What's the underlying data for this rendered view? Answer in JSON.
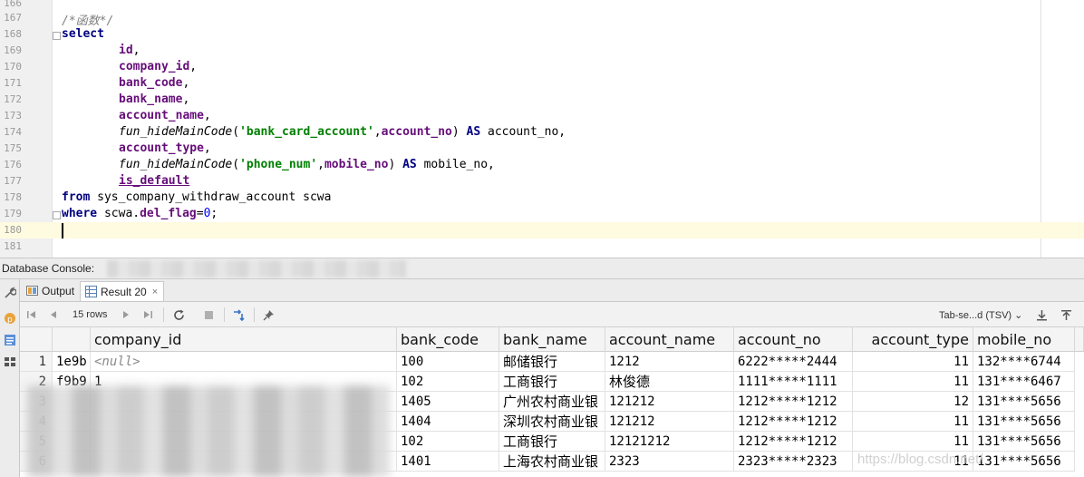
{
  "editor": {
    "lines": [
      {
        "n": "166",
        "code": ""
      },
      {
        "n": "167",
        "code": "/*函数*/"
      },
      {
        "n": "168",
        "code": "select"
      },
      {
        "n": "169",
        "code": "id,"
      },
      {
        "n": "170",
        "code": "company_id,"
      },
      {
        "n": "171",
        "code": "bank_code,"
      },
      {
        "n": "172",
        "code": "bank_name,"
      },
      {
        "n": "173",
        "code": "account_name,"
      },
      {
        "n": "174",
        "code": "fun_hideMainCode('bank_card_account',account_no) AS account_no,"
      },
      {
        "n": "175",
        "code": "account_type,"
      },
      {
        "n": "176",
        "code": "fun_hideMainCode('phone_num',mobile_no) AS mobile_no,"
      },
      {
        "n": "177",
        "code": "is_default"
      },
      {
        "n": "178",
        "code": "from sys_company_withdraw_account scwa"
      },
      {
        "n": "179",
        "code": "where scwa.del_flag=0;"
      },
      {
        "n": "180",
        "code": ""
      },
      {
        "n": "181",
        "code": ""
      }
    ],
    "tokens": {
      "comment": "/*函数*/",
      "select": "select",
      "id": "id",
      "company_id": "company_id",
      "bank_code": "bank_code",
      "bank_name": "bank_name",
      "account_name": "account_name",
      "fn1": "fun_hideMainCode",
      "str1": "'bank_card_account'",
      "account_no": "account_no",
      "as": "AS",
      "alias1": " account_no,",
      "account_type": "account_type",
      "fn2": "fun_hideMainCode",
      "str2": "'phone_num'",
      "mobile_no": "mobile_no",
      "alias2": " mobile_no,",
      "is_default": "is_default",
      "from": "from",
      "table": " sys_company_withdraw_account scwa",
      "where": "where",
      "where_rest": " scwa.",
      "del_flag": "del_flag",
      "eq": "=",
      "zero": "0",
      "semicolon": ";"
    }
  },
  "console": {
    "title": "Database Console:"
  },
  "tabs": [
    {
      "label": "Output",
      "icon": "output-icon"
    },
    {
      "label": "Result 20",
      "icon": "table-icon",
      "close": "×"
    }
  ],
  "toolbar": {
    "rows": "15 rows",
    "format": "Tab-se...d (TSV)",
    "format_arrow": "⌄"
  },
  "grid": {
    "columns": [
      "company_id",
      "bank_code",
      "bank_name",
      "account_name",
      "account_no",
      "account_type",
      "mobile_no"
    ],
    "rows": [
      {
        "num": "1",
        "id": "1e9b",
        "company_id": "<null>",
        "bank_code": "100",
        "bank_name": "邮储银行",
        "account_name": "1212",
        "account_no": "6222*****2444",
        "account_type": "11",
        "mobile_no": "132****6744"
      },
      {
        "num": "2",
        "id": "f9b9",
        "company_id": "1",
        "bank_code": "102",
        "bank_name": "工商银行",
        "account_name": "林俊德",
        "account_no": "1111*****1111",
        "account_type": "11",
        "mobile_no": "131****6467"
      },
      {
        "num": "3",
        "id": "",
        "company_id": "",
        "bank_code": "1405",
        "bank_name": "广州农村商业银",
        "account_name": "121212",
        "account_no": "1212*****1212",
        "account_type": "12",
        "mobile_no": "131****5656"
      },
      {
        "num": "4",
        "id": "",
        "company_id": "",
        "bank_code": "1404",
        "bank_name": "深圳农村商业银",
        "account_name": "121212",
        "account_no": "1212*****1212",
        "account_type": "11",
        "mobile_no": "131****5656"
      },
      {
        "num": "5",
        "id": "",
        "company_id": "",
        "bank_code": "102",
        "bank_name": "工商银行",
        "account_name": "12121212",
        "account_no": "1212*****1212",
        "account_type": "11",
        "mobile_no": "131****5656"
      },
      {
        "num": "6",
        "id": "",
        "company_id": "",
        "bank_code": "1401",
        "bank_name": "上海农村商业银",
        "account_name": "2323",
        "account_no": "2323*****2323",
        "account_type": "11",
        "mobile_no": "131****5656"
      }
    ]
  },
  "watermark": "https://blog.csdn.net/"
}
